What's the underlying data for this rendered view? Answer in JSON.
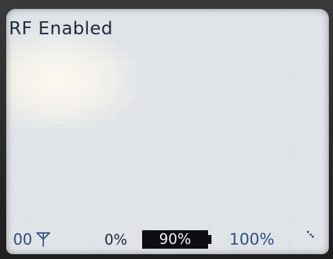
{
  "screen": {
    "title": "RF Enabled"
  },
  "status_bar": {
    "signal_value": "00",
    "signal_icon": "antenna-icon",
    "left_percent": "0%",
    "battery_level_text": "90%",
    "battery_level": 0.9,
    "right_percent": "100%",
    "corner_icon": "corner-mark-icon"
  },
  "colors": {
    "title_text": "#1e2a3c",
    "status_blue": "#2f4f86",
    "battery_fill": "#0e0e12"
  }
}
